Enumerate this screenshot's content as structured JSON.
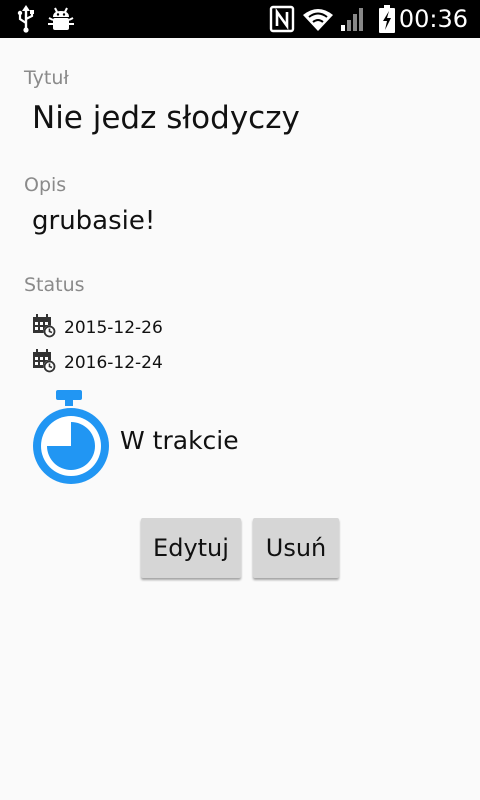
{
  "status_bar": {
    "time": "00:36",
    "icons": [
      "usb-icon",
      "android-debug-icon",
      "nfc-icon",
      "wifi-icon",
      "signal-icon",
      "battery-charging-icon"
    ]
  },
  "task": {
    "title_label": "Tytuł",
    "title_value": "Nie jedz słodyczy",
    "description_label": "Opis",
    "description_value": "grubasie!",
    "status_label": "Status",
    "start_date": "2015-12-26",
    "end_date": "2016-12-24",
    "state": "W trakcie"
  },
  "buttons": {
    "edit": "Edytuj",
    "delete": "Usuń"
  },
  "colors": {
    "accent_blue": "#2196f3",
    "status_bar_bg": "#000000",
    "background": "#fafafa",
    "button_bg": "#d6d6d6"
  }
}
